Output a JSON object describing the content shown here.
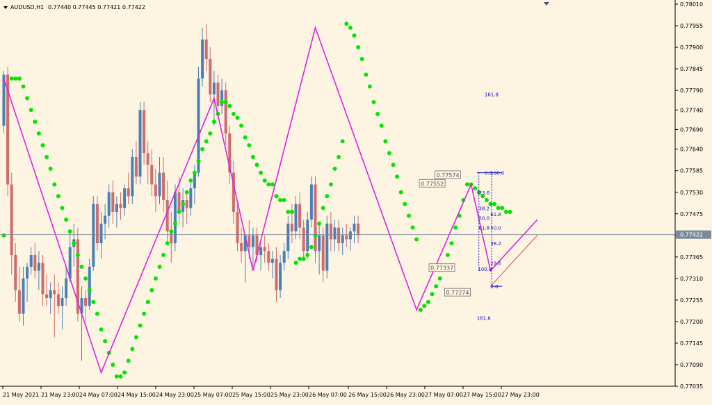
{
  "header": {
    "symbol": "AUDUSD,H1",
    "ohlc": "0.77440 0.77445 0.77421 0.77422"
  },
  "colors": {
    "background": "#fdf4e1",
    "bull": "#4a80b8",
    "bear": "#d06b6b",
    "zigzag": "#e020e0",
    "sar": "#00e600",
    "fib": "#1010cc",
    "trend": "#e04848"
  },
  "chart_data": {
    "type": "candlestick",
    "ylim": [
      0.77035,
      0.7801
    ],
    "y_ticks": [
      "0.78010",
      "0.77955",
      "0.77900",
      "0.77845",
      "0.77790",
      "0.77740",
      "0.77690",
      "0.77640",
      "0.77585",
      "0.77530",
      "0.77475",
      "0.77420",
      "0.77365",
      "0.77310",
      "0.77255",
      "0.77200",
      "0.77145",
      "0.77090",
      "0.77035"
    ],
    "current_price": "0.77422",
    "x_labels": [
      "21 May 2021",
      "21 May 23:00",
      "24 May 07:00",
      "24 May 15:00",
      "24 May 23:00",
      "25 May 07:00",
      "25 May 15:00",
      "25 May 23:00",
      "26 May 07:00",
      "26 May 15:00",
      "26 May 23:00",
      "27 May 07:00",
      "27 May 15:00",
      "27 May 23:00"
    ],
    "candles": [
      [
        0.777,
        0.7784,
        0.7768,
        0.7783
      ],
      [
        0.7783,
        0.7785,
        0.7752,
        0.7755
      ],
      [
        0.7755,
        0.7758,
        0.7732,
        0.7737
      ],
      [
        0.7737,
        0.774,
        0.7725,
        0.7728
      ],
      [
        0.7728,
        0.7734,
        0.772,
        0.7722
      ],
      [
        0.7722,
        0.7734,
        0.7719,
        0.7731
      ],
      [
        0.7731,
        0.7735,
        0.7725,
        0.7734
      ],
      [
        0.7734,
        0.7739,
        0.7732,
        0.7737
      ],
      [
        0.7737,
        0.774,
        0.7731,
        0.7733
      ],
      [
        0.7733,
        0.7738,
        0.7728,
        0.7735
      ],
      [
        0.7735,
        0.7737,
        0.7724,
        0.7727
      ],
      [
        0.7727,
        0.7732,
        0.7724,
        0.7726
      ],
      [
        0.7726,
        0.773,
        0.7722,
        0.7728
      ],
      [
        0.7728,
        0.7732,
        0.7716,
        0.7727
      ],
      [
        0.7727,
        0.773,
        0.7722,
        0.7724
      ],
      [
        0.7724,
        0.7729,
        0.7718,
        0.7726
      ],
      [
        0.7726,
        0.7734,
        0.7724,
        0.7731
      ],
      [
        0.7731,
        0.7743,
        0.773,
        0.7739
      ],
      [
        0.7739,
        0.7745,
        0.7734,
        0.7741
      ],
      [
        0.7741,
        0.7744,
        0.772,
        0.7722
      ],
      [
        0.7722,
        0.7729,
        0.771,
        0.7726
      ],
      [
        0.7726,
        0.7728,
        0.772,
        0.7724
      ],
      [
        0.7724,
        0.7736,
        0.7723,
        0.7734
      ],
      [
        0.7734,
        0.7752,
        0.7733,
        0.775
      ],
      [
        0.775,
        0.7752,
        0.7738,
        0.774
      ],
      [
        0.774,
        0.7748,
        0.7736,
        0.7745
      ],
      [
        0.7745,
        0.775,
        0.7741,
        0.7747
      ],
      [
        0.7747,
        0.7755,
        0.7744,
        0.7753
      ],
      [
        0.7753,
        0.7756,
        0.7745,
        0.7748
      ],
      [
        0.7748,
        0.7752,
        0.7744,
        0.775
      ],
      [
        0.775,
        0.7753,
        0.7746,
        0.7749
      ],
      [
        0.7749,
        0.7755,
        0.7747,
        0.7754
      ],
      [
        0.7754,
        0.7758,
        0.775,
        0.7752
      ],
      [
        0.7752,
        0.7764,
        0.775,
        0.7762
      ],
      [
        0.7762,
        0.7766,
        0.7755,
        0.7757
      ],
      [
        0.7757,
        0.7776,
        0.7755,
        0.7774
      ],
      [
        0.7774,
        0.7776,
        0.776,
        0.7763
      ],
      [
        0.7763,
        0.7766,
        0.7755,
        0.776
      ],
      [
        0.776,
        0.7764,
        0.7752,
        0.7755
      ],
      [
        0.7755,
        0.7759,
        0.7748,
        0.7752
      ],
      [
        0.7752,
        0.7762,
        0.775,
        0.7758
      ],
      [
        0.7758,
        0.7762,
        0.7748,
        0.7751
      ],
      [
        0.7751,
        0.7756,
        0.774,
        0.7743
      ],
      [
        0.7743,
        0.7748,
        0.7735,
        0.774
      ],
      [
        0.774,
        0.7755,
        0.7738,
        0.7753
      ],
      [
        0.7753,
        0.7757,
        0.7745,
        0.7748
      ],
      [
        0.7748,
        0.7754,
        0.7744,
        0.7751
      ],
      [
        0.7751,
        0.7753,
        0.7745,
        0.7749
      ],
      [
        0.7749,
        0.7756,
        0.7747,
        0.7754
      ],
      [
        0.7754,
        0.776,
        0.775,
        0.7758
      ],
      [
        0.7758,
        0.7785,
        0.7757,
        0.7782
      ],
      [
        0.7782,
        0.7795,
        0.778,
        0.7792
      ],
      [
        0.7792,
        0.7796,
        0.7784,
        0.7787
      ],
      [
        0.7787,
        0.779,
        0.7776,
        0.7778
      ],
      [
        0.7778,
        0.7784,
        0.777,
        0.7781
      ],
      [
        0.7781,
        0.7783,
        0.7772,
        0.7775
      ],
      [
        0.7775,
        0.7782,
        0.7773,
        0.7779
      ],
      [
        0.7779,
        0.7781,
        0.7765,
        0.7768
      ],
      [
        0.7768,
        0.777,
        0.7755,
        0.7758
      ],
      [
        0.7758,
        0.7761,
        0.7745,
        0.7748
      ],
      [
        0.7748,
        0.775,
        0.7738,
        0.774
      ],
      [
        0.774,
        0.7744,
        0.7735,
        0.7738
      ],
      [
        0.7738,
        0.7742,
        0.773,
        0.7742
      ],
      [
        0.7742,
        0.7746,
        0.7736,
        0.7739
      ],
      [
        0.7739,
        0.7744,
        0.7734,
        0.7742
      ],
      [
        0.7742,
        0.7744,
        0.7735,
        0.7737
      ],
      [
        0.7737,
        0.7741,
        0.7733,
        0.7739
      ],
      [
        0.7739,
        0.7742,
        0.7735,
        0.7738
      ],
      [
        0.7738,
        0.774,
        0.7733,
        0.7735
      ],
      [
        0.7735,
        0.7738,
        0.7731,
        0.7736
      ],
      [
        0.7736,
        0.7739,
        0.7725,
        0.7728
      ],
      [
        0.7728,
        0.7737,
        0.7726,
        0.7735
      ],
      [
        0.7735,
        0.774,
        0.7733,
        0.7738
      ],
      [
        0.7738,
        0.7747,
        0.7736,
        0.7745
      ],
      [
        0.7745,
        0.775,
        0.774,
        0.7743
      ],
      [
        0.7743,
        0.7752,
        0.7741,
        0.775
      ],
      [
        0.775,
        0.7753,
        0.7741,
        0.7744
      ],
      [
        0.7744,
        0.7746,
        0.7736,
        0.7738
      ],
      [
        0.7738,
        0.7748,
        0.7736,
        0.7746
      ],
      [
        0.7746,
        0.7757,
        0.7744,
        0.7755
      ],
      [
        0.7755,
        0.7757,
        0.7735,
        0.7738
      ],
      [
        0.7738,
        0.7745,
        0.7732,
        0.7742
      ],
      [
        0.7742,
        0.7744,
        0.773,
        0.7733
      ],
      [
        0.7733,
        0.7747,
        0.7731,
        0.7745
      ],
      [
        0.7745,
        0.7748,
        0.7738,
        0.7741
      ],
      [
        0.7741,
        0.7746,
        0.7738,
        0.7744
      ],
      [
        0.7744,
        0.7746,
        0.7738,
        0.774
      ],
      [
        0.774,
        0.7744,
        0.7737,
        0.7742
      ],
      [
        0.7742,
        0.7745,
        0.7739,
        0.7741
      ],
      [
        0.7741,
        0.7744,
        0.7738,
        0.7743
      ],
      [
        0.7743,
        0.7747,
        0.774,
        0.7745
      ],
      [
        0.7745,
        0.7747,
        0.774,
        0.7742
      ]
    ],
    "zigzag": [
      [
        0,
        0.7782
      ],
      [
        25,
        0.7707
      ],
      [
        54,
        0.7777
      ],
      [
        64,
        0.7733
      ],
      [
        80,
        0.7795
      ],
      [
        106,
        0.7723
      ],
      [
        120,
        0.7755
      ],
      [
        125,
        0.7733
      ],
      [
        137,
        0.7746
      ]
    ],
    "sar": [
      [
        0,
        0.7742
      ],
      [
        2,
        0.7782
      ],
      [
        3,
        0.7782
      ],
      [
        4,
        0.7782
      ],
      [
        5,
        0.778
      ],
      [
        6,
        0.7777
      ],
      [
        7,
        0.7774
      ],
      [
        8,
        0.7771
      ],
      [
        9,
        0.7768
      ],
      [
        10,
        0.7765
      ],
      [
        11,
        0.7762
      ],
      [
        12,
        0.7759
      ],
      [
        13,
        0.7755
      ],
      [
        14,
        0.7752
      ],
      [
        15,
        0.7749
      ],
      [
        16,
        0.7746
      ],
      [
        17,
        0.7743
      ],
      [
        18,
        0.774
      ],
      [
        19,
        0.7737
      ],
      [
        20,
        0.7734
      ],
      [
        21,
        0.7731
      ],
      [
        22,
        0.7728
      ],
      [
        23,
        0.7725
      ],
      [
        24,
        0.7722
      ],
      [
        25,
        0.7718
      ],
      [
        26,
        0.7715
      ],
      [
        27,
        0.7712
      ],
      [
        28,
        0.7709
      ],
      [
        29,
        0.7706
      ],
      [
        30,
        0.7706
      ],
      [
        31,
        0.7707
      ],
      [
        32,
        0.771
      ],
      [
        33,
        0.7713
      ],
      [
        34,
        0.7716
      ],
      [
        35,
        0.7719
      ],
      [
        36,
        0.7722
      ],
      [
        37,
        0.7725
      ],
      [
        38,
        0.7728
      ],
      [
        39,
        0.7731
      ],
      [
        40,
        0.7734
      ],
      [
        41,
        0.7737
      ],
      [
        42,
        0.774
      ],
      [
        43,
        0.7743
      ],
      [
        44,
        0.7745
      ],
      [
        45,
        0.7748
      ],
      [
        46,
        0.775
      ],
      [
        47,
        0.7753
      ],
      [
        48,
        0.7756
      ],
      [
        49,
        0.7758
      ],
      [
        50,
        0.7761
      ],
      [
        51,
        0.7764
      ],
      [
        52,
        0.7766
      ],
      [
        53,
        0.7768
      ],
      [
        54,
        0.7771
      ],
      [
        55,
        0.7773
      ],
      [
        56,
        0.7776
      ],
      [
        57,
        0.7776
      ],
      [
        58,
        0.7775
      ],
      [
        59,
        0.7773
      ],
      [
        60,
        0.7772
      ],
      [
        61,
        0.777
      ],
      [
        62,
        0.7767
      ],
      [
        63,
        0.7765
      ],
      [
        64,
        0.7762
      ],
      [
        65,
        0.776
      ],
      [
        66,
        0.7758
      ],
      [
        67,
        0.7756
      ],
      [
        68,
        0.7755
      ],
      [
        69,
        0.7755
      ],
      [
        70,
        0.7752
      ],
      [
        71,
        0.7751
      ],
      [
        72,
        0.7751
      ],
      [
        73,
        0.7748
      ],
      [
        74,
        0.7748
      ],
      [
        75,
        0.7735
      ],
      [
        76,
        0.7736
      ],
      [
        77,
        0.7736
      ],
      [
        78,
        0.7737
      ],
      [
        79,
        0.7739
      ],
      [
        80,
        0.7742
      ],
      [
        81,
        0.7745
      ],
      [
        82,
        0.7749
      ],
      [
        83,
        0.7752
      ],
      [
        84,
        0.7755
      ],
      [
        85,
        0.7759
      ],
      [
        86,
        0.7762
      ],
      [
        87,
        0.7766
      ],
      [
        88,
        0.7796
      ],
      [
        89,
        0.7795
      ],
      [
        90,
        0.7793
      ],
      [
        91,
        0.779
      ],
      [
        92,
        0.7787
      ],
      [
        93,
        0.7783
      ],
      [
        94,
        0.778
      ],
      [
        95,
        0.7776
      ],
      [
        96,
        0.7773
      ],
      [
        97,
        0.777
      ],
      [
        98,
        0.7766
      ],
      [
        99,
        0.7763
      ],
      [
        100,
        0.776
      ],
      [
        101,
        0.7757
      ],
      [
        102,
        0.7753
      ],
      [
        103,
        0.775
      ],
      [
        104,
        0.7747
      ],
      [
        105,
        0.7744
      ],
      [
        106,
        0.7741
      ],
      [
        107,
        0.7723
      ],
      [
        108,
        0.7724
      ],
      [
        109,
        0.7725
      ],
      [
        110,
        0.7727
      ],
      [
        111,
        0.7729
      ],
      [
        112,
        0.7731
      ],
      [
        113,
        0.7734
      ],
      [
        114,
        0.7737
      ],
      [
        115,
        0.774
      ],
      [
        116,
        0.7744
      ],
      [
        117,
        0.7747
      ],
      [
        118,
        0.7751
      ],
      [
        119,
        0.7755
      ],
      [
        120,
        0.7755
      ],
      [
        121,
        0.7754
      ],
      [
        122,
        0.7753
      ],
      [
        123,
        0.7752
      ],
      [
        124,
        0.7751
      ],
      [
        125,
        0.775
      ],
      [
        126,
        0.775
      ],
      [
        127,
        0.7749
      ],
      [
        128,
        0.7749
      ],
      [
        129,
        0.7748
      ],
      [
        130,
        0.7748
      ]
    ],
    "fib_labels": [
      {
        "text": "161.8",
        "i": 124,
        "y": 0.7778
      },
      {
        "text": "0.0",
        "i": 124,
        "y": 0.7758
      },
      {
        "text": "100.0",
        "i": 125.5,
        "y": 0.7758
      },
      {
        "text": "61.8",
        "i": 125.5,
        "y": 0.77475
      },
      {
        "text": "50.0",
        "i": 125.5,
        "y": 0.7744
      },
      {
        "text": "38.2",
        "i": 125.5,
        "y": 0.774
      },
      {
        "text": "23.6",
        "i": 125.5,
        "y": 0.7735
      },
      {
        "text": "0.0",
        "i": 125.5,
        "y": 0.7729
      },
      {
        "text": "161.8",
        "i": 122,
        "y": 0.7721
      },
      {
        "text": "23.6",
        "i": 122.5,
        "y": 0.7753
      },
      {
        "text": "38.2",
        "i": 122.5,
        "y": 0.7749
      },
      {
        "text": "50.0",
        "i": 122.5,
        "y": 0.77465
      },
      {
        "text": "61.8",
        "i": 122.5,
        "y": 0.7744
      },
      {
        "text": "100.0",
        "i": 122.3,
        "y": 0.77335
      }
    ],
    "price_boxes": [
      {
        "text": "0.77574",
        "i": 117.5,
        "y": 0.77574
      },
      {
        "text": "0.77552",
        "i": 113.5,
        "y": 0.77552
      },
      {
        "text": "0.77337",
        "i": 116,
        "y": 0.77337
      },
      {
        "text": "0.77274",
        "i": 120,
        "y": 0.77274
      }
    ]
  }
}
